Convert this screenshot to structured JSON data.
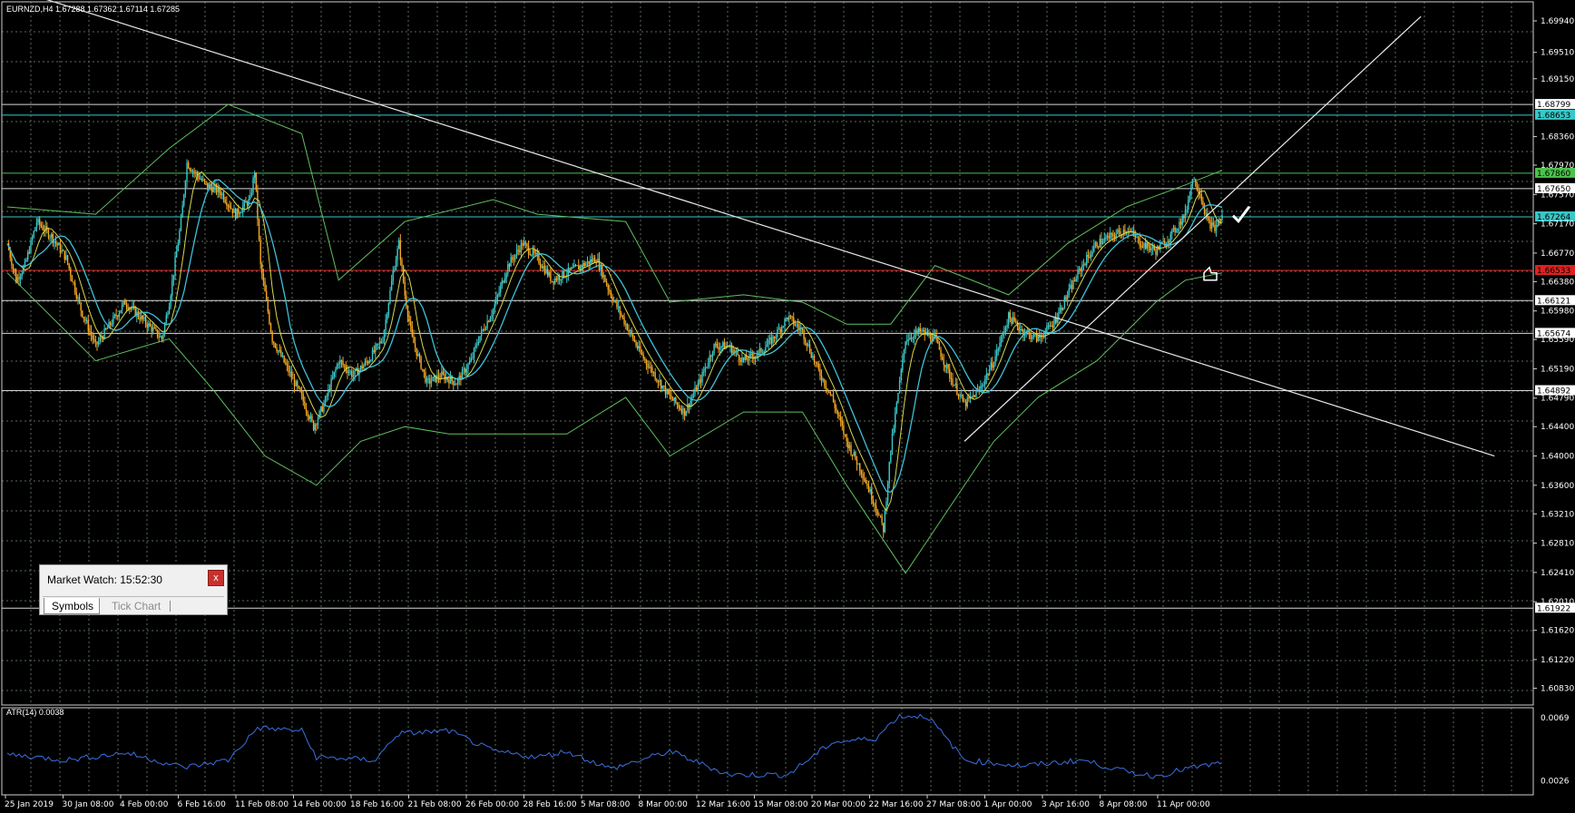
{
  "window": {
    "symbol_line": "EURNZD,H4  1.67288 1.67362 1.67114 1.67285",
    "indicator_label": "ATR(14) 0.0038"
  },
  "colors": {
    "background": "#000000",
    "grid": "#5a6b5a",
    "candle_up": "#3cc8c8",
    "candle_down": "#f5a623",
    "bands": "#5fbf5f",
    "ma_fast": "#d8d84a",
    "ma_slow": "#3fc0d8",
    "trendline": "#e8e8e8",
    "level_cyan": "#38c8c8",
    "level_green": "#4cc24c",
    "level_red": "#e02020",
    "level_white": "#d8d8d8",
    "atr_line": "#3a6fe0"
  },
  "price_axis": {
    "ticks": [
      "1.69940",
      "1.69510",
      "1.69150",
      "1.68360",
      "1.67970",
      "1.67570",
      "1.67170",
      "1.66770",
      "1.66380",
      "1.65980",
      "1.65590",
      "1.65190",
      "1.64790",
      "1.64400",
      "1.64000",
      "1.63600",
      "1.63210",
      "1.62810",
      "1.62410",
      "1.62010",
      "1.61620",
      "1.61220",
      "1.60830"
    ],
    "tags": [
      {
        "label": "1.68799",
        "kind": "white"
      },
      {
        "label": "1.68653",
        "kind": "cyan"
      },
      {
        "label": "1.67860",
        "kind": "green"
      },
      {
        "label": "1.67650",
        "kind": "white"
      },
      {
        "label": "1.67264",
        "kind": "cyan"
      },
      {
        "label": "1.66533",
        "kind": "red"
      },
      {
        "label": "1.66121",
        "kind": "white"
      },
      {
        "label": "1.65674",
        "kind": "white"
      },
      {
        "label": "1.64892",
        "kind": "white"
      },
      {
        "label": "1.61922",
        "kind": "white"
      }
    ]
  },
  "atr_axis": {
    "ticks": [
      "0.0069",
      "0.0026"
    ]
  },
  "time_axis": {
    "labels": [
      "25 Jan 2019",
      "30 Jan 08:00",
      "4 Feb 00:00",
      "6 Feb 16:00",
      "11 Feb 08:00",
      "14 Feb 00:00",
      "18 Feb 16:00",
      "21 Feb 08:00",
      "26 Feb 00:00",
      "28 Feb 16:00",
      "5 Mar 08:00",
      "8 Mar 00:00",
      "12 Mar 16:00",
      "15 Mar 08:00",
      "20 Mar 00:00",
      "22 Mar 16:00",
      "27 Mar 08:00",
      "1 Apr 00:00",
      "3 Apr 16:00",
      "8 Apr 08:00",
      "11 Apr 00:00"
    ]
  },
  "market_watch": {
    "title": "Market Watch: 15:52:30",
    "close_label": "x",
    "tabs": [
      "Symbols",
      "Tick Chart"
    ]
  },
  "chart_data": {
    "type": "candlestick",
    "symbol": "EURNZD",
    "timeframe": "H4",
    "ohlc_last": {
      "open": 1.67288,
      "high": 1.67362,
      "low": 1.67114,
      "close": 1.67285
    },
    "price_range": [
      1.606,
      1.702
    ],
    "horizontal_levels": [
      1.68799,
      1.68653,
      1.6786,
      1.6765,
      1.67264,
      1.66533,
      1.66121,
      1.65674,
      1.64892,
      1.61922
    ],
    "close_path": [
      [
        0,
        1.669
      ],
      [
        6,
        1.664
      ],
      [
        12,
        1.666
      ],
      [
        20,
        1.672
      ],
      [
        30,
        1.67
      ],
      [
        40,
        1.667
      ],
      [
        50,
        1.66
      ],
      [
        60,
        1.655
      ],
      [
        70,
        1.658
      ],
      [
        80,
        1.661
      ],
      [
        90,
        1.659
      ],
      [
        100,
        1.657
      ],
      [
        105,
        1.656
      ],
      [
        110,
        1.661
      ],
      [
        118,
        1.672
      ],
      [
        122,
        1.68
      ],
      [
        126,
        1.679
      ],
      [
        135,
        1.677
      ],
      [
        145,
        1.676
      ],
      [
        155,
        1.673
      ],
      [
        165,
        1.675
      ],
      [
        168,
        1.679
      ],
      [
        172,
        1.666
      ],
      [
        180,
        1.656
      ],
      [
        190,
        1.652
      ],
      [
        200,
        1.648
      ],
      [
        208,
        1.644
      ],
      [
        215,
        1.647
      ],
      [
        225,
        1.653
      ],
      [
        235,
        1.651
      ],
      [
        245,
        1.653
      ],
      [
        255,
        1.656
      ],
      [
        262,
        1.665
      ],
      [
        266,
        1.669
      ],
      [
        270,
        1.662
      ],
      [
        275,
        1.656
      ],
      [
        285,
        1.65
      ],
      [
        295,
        1.651
      ],
      [
        305,
        1.65
      ],
      [
        315,
        1.653
      ],
      [
        320,
        1.656
      ],
      [
        330,
        1.66
      ],
      [
        340,
        1.666
      ],
      [
        350,
        1.669
      ],
      [
        360,
        1.667
      ],
      [
        370,
        1.664
      ],
      [
        380,
        1.665
      ],
      [
        390,
        1.666
      ],
      [
        400,
        1.667
      ],
      [
        410,
        1.662
      ],
      [
        420,
        1.658
      ],
      [
        430,
        1.654
      ],
      [
        440,
        1.651
      ],
      [
        450,
        1.648
      ],
      [
        460,
        1.646
      ],
      [
        470,
        1.65
      ],
      [
        480,
        1.655
      ],
      [
        490,
        1.655
      ],
      [
        500,
        1.653
      ],
      [
        510,
        1.654
      ],
      [
        520,
        1.656
      ],
      [
        530,
        1.659
      ],
      [
        540,
        1.657
      ],
      [
        550,
        1.652
      ],
      [
        560,
        1.648
      ],
      [
        570,
        1.642
      ],
      [
        580,
        1.638
      ],
      [
        590,
        1.633
      ],
      [
        595,
        1.63
      ],
      [
        600,
        1.641
      ],
      [
        610,
        1.656
      ],
      [
        620,
        1.657
      ],
      [
        630,
        1.656
      ],
      [
        640,
        1.651
      ],
      [
        650,
        1.647
      ],
      [
        660,
        1.649
      ],
      [
        670,
        1.653
      ],
      [
        680,
        1.659
      ],
      [
        690,
        1.657
      ],
      [
        700,
        1.656
      ],
      [
        710,
        1.658
      ],
      [
        720,
        1.662
      ],
      [
        730,
        1.666
      ],
      [
        740,
        1.669
      ],
      [
        750,
        1.67
      ],
      [
        760,
        1.671
      ],
      [
        770,
        1.669
      ],
      [
        780,
        1.668
      ],
      [
        790,
        1.67
      ],
      [
        800,
        1.673
      ],
      [
        805,
        1.678
      ],
      [
        810,
        1.676
      ],
      [
        815,
        1.672
      ],
      [
        820,
        1.671
      ],
      [
        825,
        1.6728
      ]
    ],
    "bollinger": {
      "upper": [
        [
          0,
          1.674
        ],
        [
          60,
          1.673
        ],
        [
          110,
          1.682
        ],
        [
          150,
          1.688
        ],
        [
          200,
          1.684
        ],
        [
          225,
          1.664
        ],
        [
          270,
          1.672
        ],
        [
          330,
          1.675
        ],
        [
          360,
          1.673
        ],
        [
          420,
          1.672
        ],
        [
          450,
          1.661
        ],
        [
          500,
          1.662
        ],
        [
          540,
          1.661
        ],
        [
          570,
          1.658
        ],
        [
          600,
          1.658
        ],
        [
          630,
          1.666
        ],
        [
          680,
          1.662
        ],
        [
          720,
          1.669
        ],
        [
          760,
          1.674
        ],
        [
          800,
          1.677
        ],
        [
          825,
          1.679
        ]
      ],
      "lower": [
        [
          0,
          1.665
        ],
        [
          60,
          1.653
        ],
        [
          110,
          1.656
        ],
        [
          140,
          1.649
        ],
        [
          175,
          1.64
        ],
        [
          210,
          1.636
        ],
        [
          240,
          1.642
        ],
        [
          270,
          1.644
        ],
        [
          300,
          1.643
        ],
        [
          340,
          1.643
        ],
        [
          380,
          1.643
        ],
        [
          420,
          1.648
        ],
        [
          450,
          1.64
        ],
        [
          500,
          1.646
        ],
        [
          540,
          1.646
        ],
        [
          570,
          1.636
        ],
        [
          610,
          1.624
        ],
        [
          640,
          1.633
        ],
        [
          670,
          1.642
        ],
        [
          700,
          1.648
        ],
        [
          740,
          1.653
        ],
        [
          780,
          1.661
        ],
        [
          800,
          1.664
        ],
        [
          825,
          1.665
        ]
      ]
    },
    "trendlines": [
      {
        "name": "descending",
        "from": [
          0,
          1.704
        ],
        "to": [
          1010,
          1.64
        ]
      },
      {
        "name": "ascending",
        "from": [
          650,
          1.642
        ],
        "to": [
          960,
          1.7
        ]
      }
    ],
    "atr": {
      "label": "ATR(14)",
      "current": 0.0038,
      "range": [
        0.002,
        0.0072
      ],
      "values": [
        [
          0,
          0.0044
        ],
        [
          40,
          0.004
        ],
        [
          80,
          0.0045
        ],
        [
          120,
          0.0035
        ],
        [
          150,
          0.004
        ],
        [
          170,
          0.0062
        ],
        [
          200,
          0.006
        ],
        [
          210,
          0.0042
        ],
        [
          250,
          0.004
        ],
        [
          265,
          0.0058
        ],
        [
          300,
          0.006
        ],
        [
          330,
          0.0046
        ],
        [
          360,
          0.0042
        ],
        [
          380,
          0.0046
        ],
        [
          410,
          0.0034
        ],
        [
          450,
          0.0046
        ],
        [
          490,
          0.003
        ],
        [
          530,
          0.003
        ],
        [
          560,
          0.0052
        ],
        [
          590,
          0.0055
        ],
        [
          605,
          0.007
        ],
        [
          625,
          0.007
        ],
        [
          650,
          0.004
        ],
        [
          690,
          0.0036
        ],
        [
          730,
          0.004
        ],
        [
          760,
          0.0032
        ],
        [
          780,
          0.0029
        ],
        [
          800,
          0.0034
        ],
        [
          825,
          0.0038
        ]
      ]
    }
  }
}
